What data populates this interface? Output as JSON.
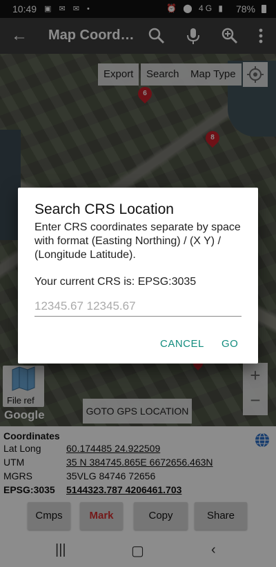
{
  "statusbar": {
    "time": "10:49",
    "signal": "4G",
    "battery": "78%"
  },
  "toolbar": {
    "title": "Map Coordinates"
  },
  "map": {
    "buttons": {
      "export": "Export",
      "search": "Search",
      "map_type": "Map Type"
    },
    "markers": [
      "6",
      "8"
    ],
    "file_ref": "File ref",
    "google": "Google",
    "goto_gps": "GOTO GPS LOCATION",
    "zoom_in": "+",
    "zoom_out": "−"
  },
  "panel": {
    "heading": "Coordinates",
    "rows": [
      {
        "label": "Lat Long",
        "value": "60.174485 24.922509"
      },
      {
        "label": "UTM",
        "value": "35 N 384745.865E 6672656.463N"
      },
      {
        "label": "MGRS",
        "value": "35VLG 84746 72656"
      },
      {
        "label": "EPSG:3035",
        "value": "5144323.787 4206461.703"
      }
    ],
    "buttons": {
      "cmps": "Cmps",
      "mark": "Mark",
      "copy": "Copy",
      "share": "Share"
    }
  },
  "dialog": {
    "title": "Search CRS Location",
    "message": "Enter CRS coordinates separate by space with format (Easting Northing) / (X Y) / (Longitude Latitude).",
    "current_crs": "Your current CRS is: EPSG:3035",
    "input_placeholder": "12345.67 12345.67",
    "cancel": "CANCEL",
    "go": "GO"
  },
  "colors": {
    "accent": "#128c7e",
    "mark": "#d32f2f",
    "marker": "#c8202a",
    "toolbar": "#3d3d3d"
  }
}
